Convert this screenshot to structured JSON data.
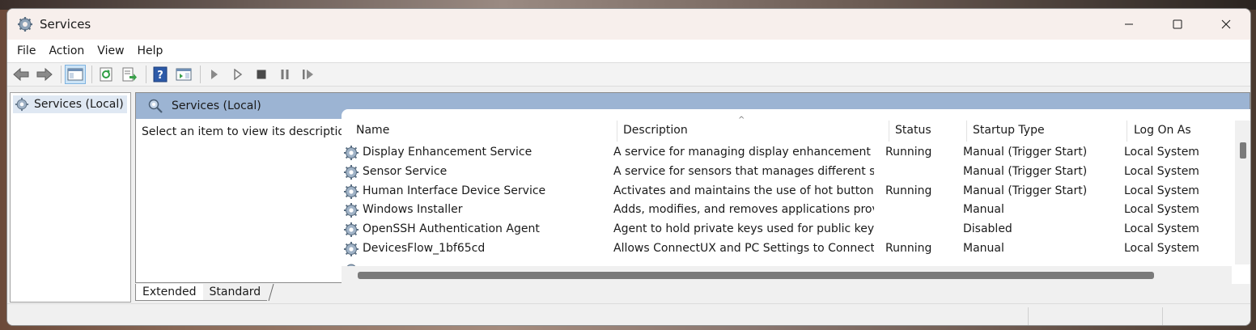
{
  "window": {
    "title": "Services",
    "title_icon": "gear-cog-icon"
  },
  "controls": {
    "minimize": "minimize-icon",
    "maximize": "maximize-icon",
    "close": "close-icon"
  },
  "menu": [
    "File",
    "Action",
    "View",
    "Help"
  ],
  "toolbar_icons": [
    "back-arrow-icon",
    "forward-arrow-icon",
    "show-hide-console-tree-icon",
    "refresh-icon",
    "export-list-icon",
    "help-icon",
    "show-hide-action-pane-icon",
    "start-service-icon",
    "start-service-alt-icon",
    "stop-service-icon",
    "pause-service-icon",
    "resume-service-icon"
  ],
  "tree": {
    "item": "Services (Local)"
  },
  "main": {
    "header": "Services (Local)",
    "description_prompt": "Select an item to view its description.",
    "sort_indicator": "^",
    "columns": [
      "Name",
      "Description",
      "Status",
      "Startup Type",
      "Log On As"
    ],
    "rows": [
      {
        "name": "Display Enhancement Service",
        "description": "A service for managing display enhancement su...",
        "status": "Running",
        "startup": "Manual (Trigger Start)",
        "logon": "Local System"
      },
      {
        "name": "Sensor Service",
        "description": "A service for sensors that manages different sen...",
        "status": "",
        "startup": "Manual (Trigger Start)",
        "logon": "Local System"
      },
      {
        "name": "Human Interface Device Service",
        "description": "Activates and maintains the use of hot buttons ...",
        "status": "Running",
        "startup": "Manual (Trigger Start)",
        "logon": "Local System"
      },
      {
        "name": "Windows Installer",
        "description": "Adds, modifies, and removes applications provi...",
        "status": "",
        "startup": "Manual",
        "logon": "Local System"
      },
      {
        "name": "OpenSSH Authentication Agent",
        "description": "Agent to hold private keys used for public key a...",
        "status": "",
        "startup": "Disabled",
        "logon": "Local System"
      },
      {
        "name": "DevicesFlow_1bf65cd",
        "description": "Allows ConnectUX and PC Settings to Connect a...",
        "status": "Running",
        "startup": "Manual",
        "logon": "Local System"
      }
    ]
  },
  "tabs": [
    "Extended",
    "Standard"
  ],
  "active_tab": "Extended"
}
